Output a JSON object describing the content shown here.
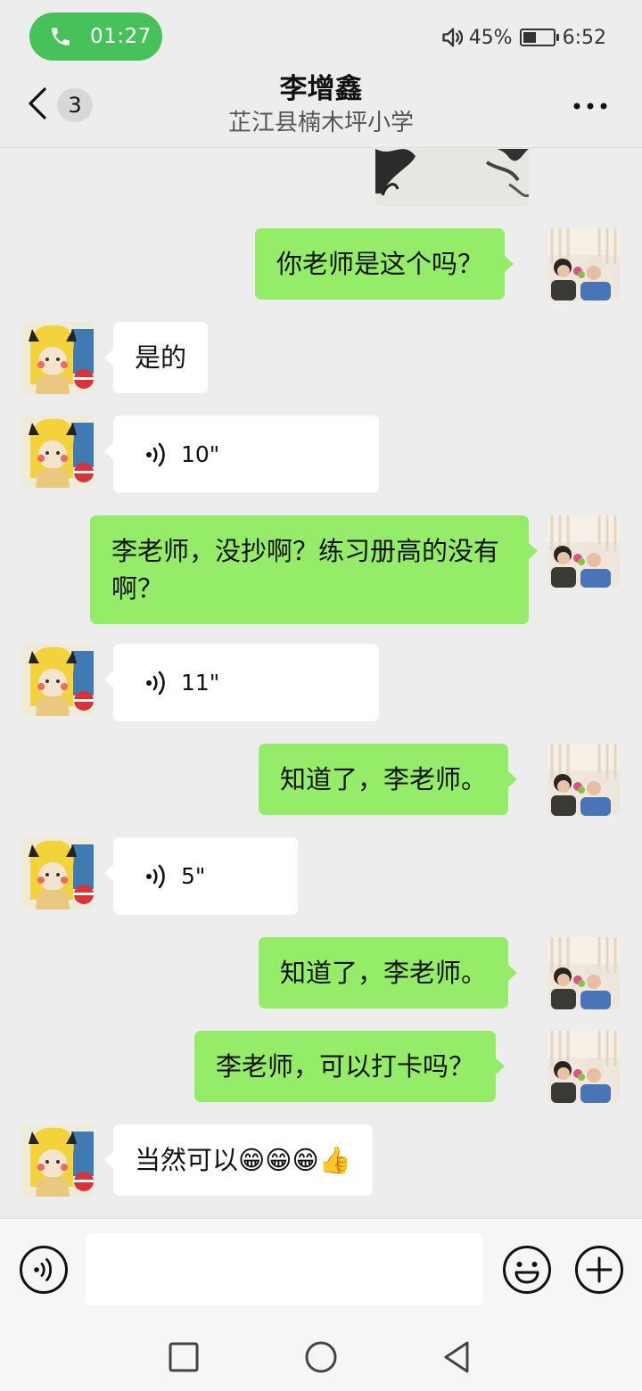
{
  "status_bar": {
    "call_time": "01:27",
    "battery_text": "45%",
    "battery_level": 0.45,
    "clock": "6:52",
    "icons": [
      "phone-icon",
      "volume-icon",
      "battery-icon"
    ]
  },
  "header": {
    "unread_count": "3",
    "title": "李增鑫",
    "subtitle": "芷江县楠木坪小学",
    "icons": [
      "back-arrow-icon",
      "more-icon"
    ]
  },
  "messages": [
    {
      "type": "image",
      "from": "me"
    },
    {
      "type": "text",
      "from": "me",
      "text": "你老师是这个吗？"
    },
    {
      "type": "text",
      "from": "them",
      "text": "是的"
    },
    {
      "type": "voice",
      "from": "them",
      "duration": "10\""
    },
    {
      "type": "text",
      "from": "me",
      "text": "李老师，没抄啊？练习册高的没有啊？"
    },
    {
      "type": "voice",
      "from": "them",
      "duration": "11\""
    },
    {
      "type": "text",
      "from": "me",
      "text": "知道了，李老师。"
    },
    {
      "type": "voice",
      "from": "them",
      "duration": "5\""
    },
    {
      "type": "text",
      "from": "me",
      "text": "知道了，李老师。"
    },
    {
      "type": "text",
      "from": "me",
      "text": "李老师，可以打卡吗？"
    },
    {
      "type": "text",
      "from": "them",
      "text": "当然可以😁😁😁👍"
    }
  ],
  "input_bar": {
    "value": "",
    "icons": [
      "voice-mode-icon",
      "emoji-icon",
      "plus-icon"
    ]
  },
  "nav_bar": {
    "icons": [
      "recent-apps-icon",
      "home-icon",
      "back-icon"
    ]
  },
  "colors": {
    "background": "#ededed",
    "outgoing_bubble": "#95ec69",
    "incoming_bubble": "#ffffff",
    "call_pill": "#47c15a"
  }
}
